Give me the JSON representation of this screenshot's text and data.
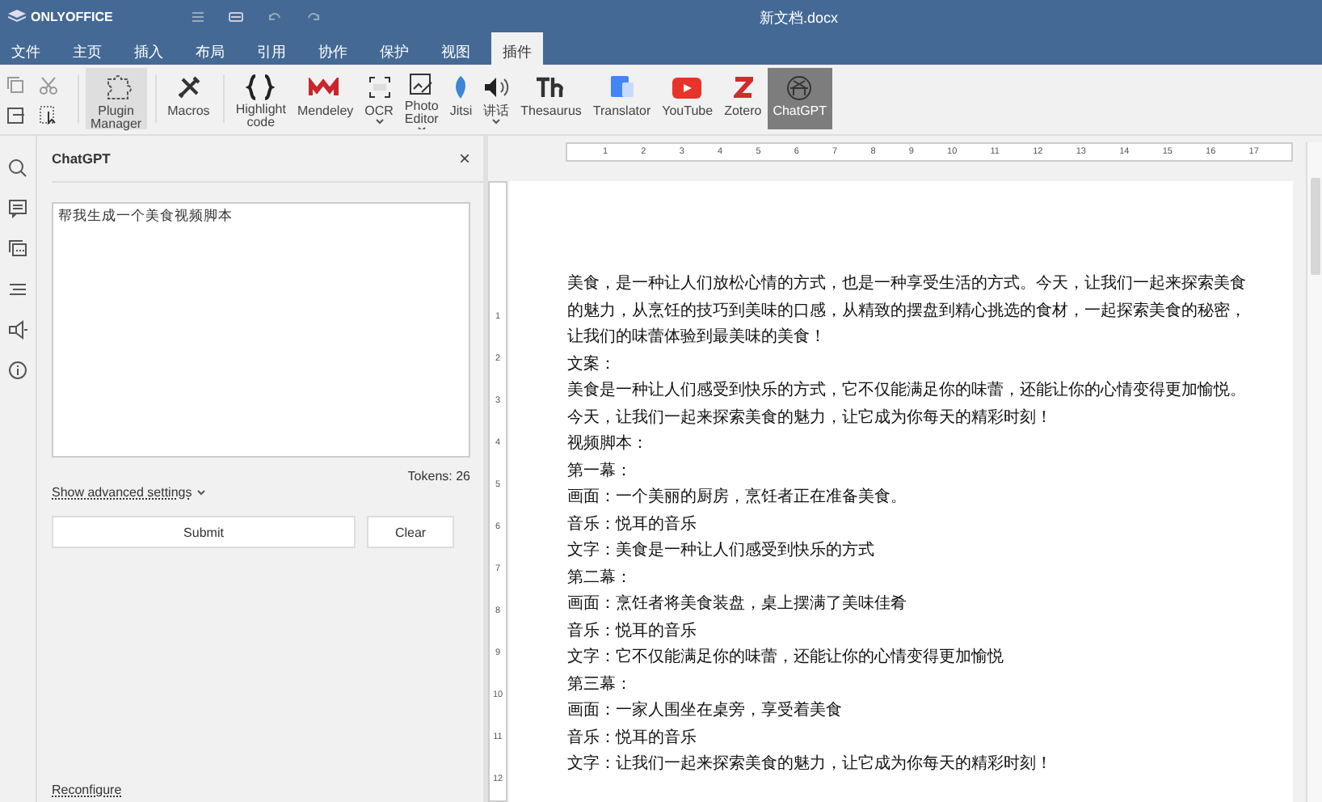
{
  "window": {
    "app_name": "ONLYOFFICE",
    "title": "新文档.docx"
  },
  "menu_tabs": [
    {
      "label": "文件",
      "selected": false
    },
    {
      "label": "主页",
      "selected": false
    },
    {
      "label": "插入",
      "selected": false
    },
    {
      "label": "布局",
      "selected": false
    },
    {
      "label": "引用",
      "selected": false
    },
    {
      "label": "协作",
      "selected": false
    },
    {
      "label": "保护",
      "selected": false
    },
    {
      "label": "视图",
      "selected": false
    },
    {
      "label": "插件",
      "selected": true
    }
  ],
  "toolbar": [
    {
      "label": "Plugin Manager",
      "has_menu": false,
      "selected": false,
      "hovered": true
    },
    {
      "label": "Macros",
      "has_menu": false,
      "selected": false,
      "hovered": false
    },
    {
      "label": "Highlight code",
      "has_menu": false,
      "selected": false,
      "hovered": false
    },
    {
      "label": "Mendeley",
      "has_menu": false,
      "selected": false,
      "hovered": false
    },
    {
      "label": "OCR",
      "has_menu": true,
      "selected": false,
      "hovered": false
    },
    {
      "label": "Photo Editor",
      "has_menu": true,
      "selected": false,
      "hovered": false
    },
    {
      "label": "Jitsi",
      "has_menu": false,
      "selected": false,
      "hovered": false
    },
    {
      "label": "讲话",
      "has_menu": true,
      "selected": false,
      "hovered": false
    },
    {
      "label": "Thesaurus",
      "has_menu": false,
      "selected": false,
      "hovered": false
    },
    {
      "label": "Translator",
      "has_menu": false,
      "selected": false,
      "hovered": false
    },
    {
      "label": "YouTube",
      "has_menu": false,
      "selected": false,
      "hovered": false
    },
    {
      "label": "Zotero",
      "has_menu": false,
      "selected": false,
      "hovered": false
    },
    {
      "label": "ChatGPT",
      "has_menu": false,
      "selected": true,
      "hovered": false
    }
  ],
  "chat_panel": {
    "title": "ChatGPT",
    "close": "×",
    "prompt": "帮我生成一个美食视频脚本",
    "tokens": "Tokens: 26",
    "advanced_link": "Show advanced settings",
    "buttons": [
      "Submit",
      "Clear"
    ],
    "footer_link": "Reconfigure"
  },
  "ruler": {
    "horizontal": [
      "1",
      "2",
      "3",
      "4",
      "5",
      "6",
      "7",
      "8",
      "9",
      "10",
      "11",
      "12",
      "13",
      "14",
      "15",
      "16",
      "17"
    ],
    "vertical": [
      "1",
      "2",
      "3",
      "4",
      "5",
      "6",
      "7",
      "8",
      "9",
      "10",
      "11",
      "12"
    ]
  },
  "document": {
    "paragraphs": [
      "美食，是一种让人们放松心情的方式，也是一种享受生活的方式。今天，让我们一起来探索美食的魅力，从烹饪的技巧到美味的口感，从精致的摆盘到精心挑选的食材，一起探索美食的秘密，让我们的味蕾体验到最美味的美食！",
      "文案：",
      "美食是一种让人们感受到快乐的方式，它不仅能满足你的味蕾，还能让你的心情变得更加愉悦。今天，让我们一起来探索美食的魅力，让它成为你每天的精彩时刻！",
      "视频脚本：",
      "第一幕：",
      "画面：一个美丽的厨房，烹饪者正在准备美食。",
      "音乐：悦耳的音乐",
      "文字：美食是一种让人们感受到快乐的方式",
      "第二幕：",
      "画面：烹饪者将美食装盘，桌上摆满了美味佳肴",
      "音乐：悦耳的音乐",
      "文字：它不仅能满足你的味蕾，还能让你的心情变得更加愉悦",
      "第三幕：",
      "画面：一家人围坐在桌旁，享受着美食",
      "音乐：悦耳的音乐",
      "文字：让我们一起来探索美食的魅力，让它成为你每天的精彩时刻！"
    ]
  }
}
